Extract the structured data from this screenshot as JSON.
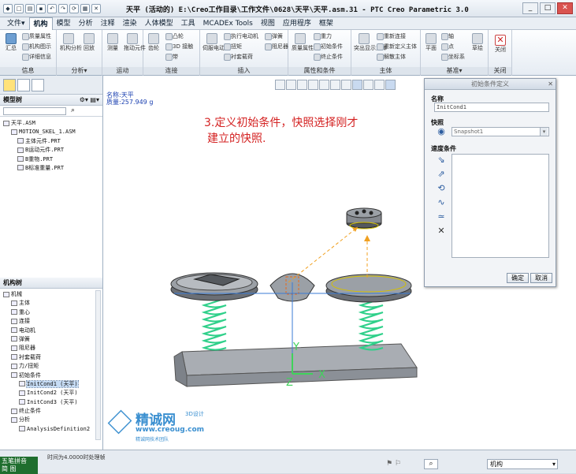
{
  "window": {
    "title": "天平 (活动的) E:\\Creo工作目录\\工作文件\\0628\\天平\\天平.asm.31 - PTC Creo Parametric 3.0",
    "controls": [
      "_",
      "□",
      "✕"
    ]
  },
  "menu": {
    "tabs": [
      "文件▾",
      "机构",
      "模型",
      "分析",
      "注释",
      "渲染",
      "人体模型",
      "工具",
      "MCADEx Tools",
      "视图",
      "应用程序",
      "框架"
    ],
    "active": 1
  },
  "ribbon": {
    "groups": [
      {
        "label": "信息",
        "buttons": [
          "汇总",
          "质量属性",
          "机构图示",
          "详细信息"
        ]
      },
      {
        "label": "分析▾",
        "buttons": [
          "机构分析",
          "回放"
        ]
      },
      {
        "label": "运动",
        "buttons": [
          "测量",
          "拖动元件"
        ]
      },
      {
        "label": "连接",
        "buttons": [
          "齿轮",
          "凸轮",
          "3D 接触",
          "带"
        ]
      },
      {
        "label": "插入",
        "buttons": [
          "伺服电动机",
          "执行电动机",
          "弹簧",
          "扭矩",
          "阻尼器",
          "衬套载荷"
        ]
      },
      {
        "label": "属性和条件",
        "buttons": [
          "质量属性",
          "重力",
          "初始条件",
          "终止条件"
        ]
      },
      {
        "label": "主体",
        "buttons": [
          "突出显示主体",
          "重新连接",
          "重新定义主体",
          "解散主体"
        ]
      },
      {
        "label": "基准▾",
        "buttons": [
          "平面",
          "轴",
          "点",
          "坐标系",
          "草绘"
        ]
      },
      {
        "label": "关闭",
        "buttons": [
          "关闭"
        ]
      }
    ]
  },
  "model_tree": {
    "header": "模型树",
    "items": [
      "天平.ASM",
      "MOTION_SKEL_1.ASM",
      "主体元件.PRT",
      "B运动元件.PRT",
      "B重物.PRT",
      "B标准重量.PRT"
    ]
  },
  "mech_tree": {
    "header": "机构树",
    "items": [
      {
        "label": "机械",
        "indent": 0,
        "selected": false
      },
      {
        "label": "主体",
        "indent": 1,
        "selected": false
      },
      {
        "label": "重心",
        "indent": 1,
        "selected": false
      },
      {
        "label": "连接",
        "indent": 1,
        "selected": false
      },
      {
        "label": "电动机",
        "indent": 1,
        "selected": false
      },
      {
        "label": "弹簧",
        "indent": 1,
        "selected": false
      },
      {
        "label": "阻尼器",
        "indent": 1,
        "selected": false
      },
      {
        "label": "衬套载荷",
        "indent": 1,
        "selected": false
      },
      {
        "label": "力/扭矩",
        "indent": 1,
        "selected": false
      },
      {
        "label": "初始条件",
        "indent": 1,
        "selected": false
      },
      {
        "label": "InitCond1 (天平)",
        "indent": 2,
        "selected": true
      },
      {
        "label": "InitCond2 (天平)",
        "indent": 2,
        "selected": false
      },
      {
        "label": "InitCond3 (天平)",
        "indent": 2,
        "selected": false
      },
      {
        "label": "终止条件",
        "indent": 1,
        "selected": false
      },
      {
        "label": "分析",
        "indent": 1,
        "selected": false
      },
      {
        "label": "AnalysisDefinition2",
        "indent": 2,
        "selected": false
      }
    ]
  },
  "model_info": {
    "line1": "名称:天平",
    "line2": "质量:257.949 g"
  },
  "annotation": {
    "line1": "3.定义初始条件，快照选择刚才",
    "line2": "建立的快照."
  },
  "dialog": {
    "title": "初始条件定义",
    "name_label": "名称",
    "name_value": "InitCond1",
    "snapshot_label": "快照",
    "snapshot_value": "Snapshot1",
    "velocity_label": "速度条件",
    "ok": "确定",
    "cancel": "取消"
  },
  "watermark": {
    "brand": "精诚网",
    "sub": "3D设计",
    "url": "www.creoug.com",
    "slogan": "精诚网技术团队"
  },
  "status": {
    "message": "时间为4.0000时处理帧",
    "mode": "机构",
    "task": "五笔拼音",
    "task2": "简 图"
  },
  "colors": {
    "accent": "#2c5da0",
    "annotation": "#d42222",
    "spring": "#2fd08a"
  }
}
